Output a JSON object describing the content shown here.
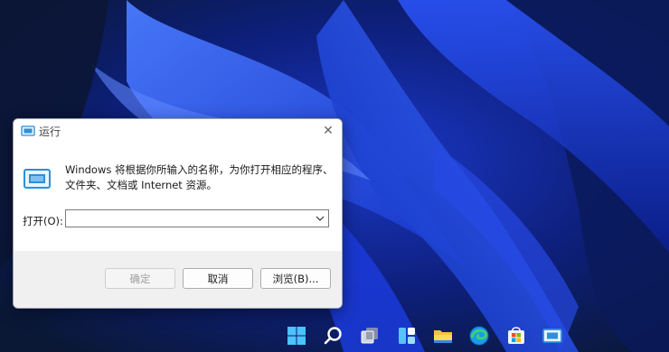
{
  "dialog": {
    "title": "运行",
    "close_glyph": "✕",
    "description": "Windows 将根据你所输入的名称，为你打开相应的程序、文件夹、文档或 Internet 资源。",
    "open_label": "打开(O):",
    "open_value": "",
    "ok_label": "确定",
    "cancel_label": "取消",
    "browse_label": "浏览(B)..."
  },
  "taskbar": {
    "icons": [
      "start-icon",
      "search-icon",
      "task-view-icon",
      "widgets-icon",
      "file-explorer-icon",
      "edge-icon",
      "store-icon",
      "run-icon"
    ]
  },
  "colors": {
    "accent": "#1f6fd1",
    "wallpaper_dark": "#0a1a4a",
    "wallpaper_blue": "#1e3fd8"
  }
}
